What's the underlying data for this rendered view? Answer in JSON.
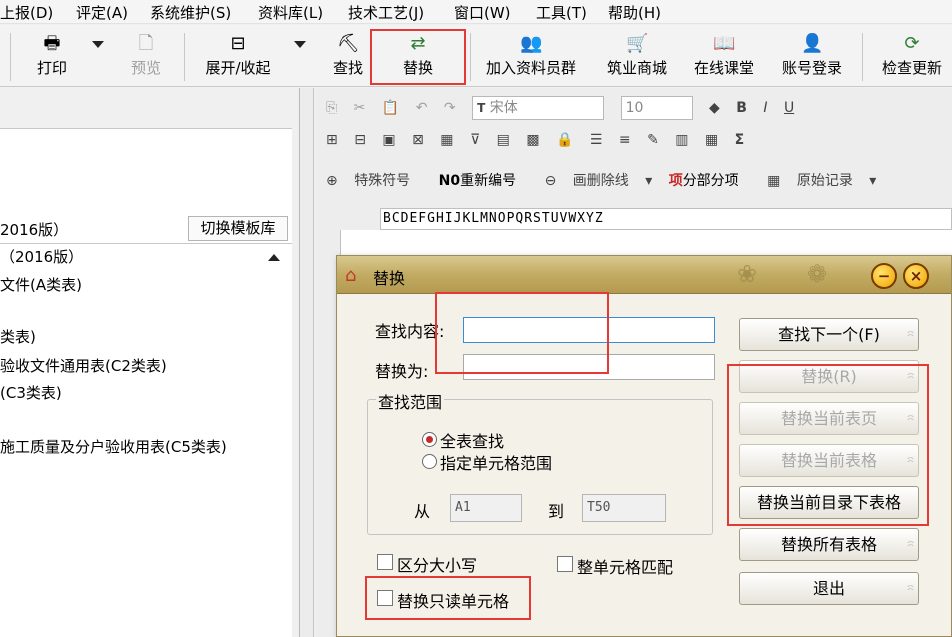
{
  "menu": [
    "上报(D)",
    "评定(A)",
    "系统维护(S)",
    "资料库(L)",
    "技术工艺(J)",
    "窗口(W)",
    "工具(T)",
    "帮助(H)"
  ],
  "toolbar": {
    "print": "打印",
    "preview": "预览",
    "expand": "展开/收起",
    "find": "查找",
    "replace": "替换",
    "join_group": "加入资料员群",
    "mall": "筑业商城",
    "online_class": "在线课堂",
    "login": "账号登录",
    "check_update": "检查更新"
  },
  "format_bar": {
    "font_name": "宋体",
    "font_size": "10",
    "bold": "B",
    "italic": "I",
    "underline": "U",
    "sigma": "Σ",
    "special_char": "特殊符号",
    "renumber": "重新编号",
    "strikethrough": "画删除线",
    "subitems": "分部分项",
    "original_record": "原始记录",
    "renumber_prefix": "N0"
  },
  "column_header": "BCDEFGHIJKLMNOPQRSTUVWXYZ",
  "left_panel": {
    "template_version": "2016版）",
    "switch_template": "切换模板库",
    "tree": [
      "（2016版）",
      "文件(A类表)",
      "类表)",
      "验收文件通用表(C2类表)",
      "(C3类表)",
      "施工质量及分户验收用表(C5类表)"
    ]
  },
  "dialog": {
    "title": "替换",
    "find_label": "查找内容:",
    "find_value": "",
    "replace_label": "替换为:",
    "replace_value": "",
    "scope_legend": "查找范围",
    "scope_all": "全表查找",
    "scope_range": "指定单元格范围",
    "from_label": "从",
    "from_value": "A1",
    "to_label": "到",
    "to_value": "T50",
    "case_sensitive": "区分大小写",
    "whole_cell": "整单元格匹配",
    "replace_readonly": "替换只读单元格",
    "buttons": {
      "find_next": "查找下一个(F)",
      "replace": "替换(R)",
      "replace_page": "替换当前表页",
      "replace_table": "替换当前表格",
      "replace_dir": "替换当前目录下表格",
      "replace_all": "替换所有表格",
      "exit": "退出"
    }
  },
  "accent": {
    "highlight": "#e53935",
    "dialog_title": "#c2ab63"
  }
}
